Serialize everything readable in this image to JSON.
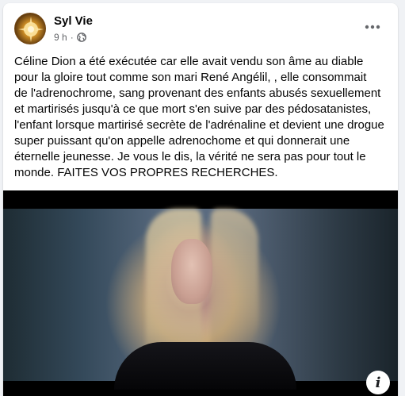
{
  "post": {
    "author": "Syl Vie",
    "time": "9 h",
    "separator": "·",
    "privacy_icon": "globe-icon",
    "more_icon": "more-options-icon",
    "text": "Céline Dion a été exécutée car elle avait vendu son âme au diable\npour la gloire tout comme son mari René Angélil, , elle consommait\nde l'adrenochrome, sang provenant des enfants abusés sexuellement\net martirisés jusqu'à ce que mort s'en suive par des pédosatanistes,\nl'enfant lorsque martirisé secrète de l'adrénaline et devient une drogue\nsuper puissant qu'on appelle adrenochome et qui donnerait une\néternelle jeunesse. Je vous le dis, la vérité ne sera pas pour tout le\nmonde. FAITES VOS PROPRES RECHERCHES."
  },
  "media": {
    "info_label": "i",
    "info_icon": "info-icon"
  },
  "colors": {
    "text": "#050505",
    "meta": "#65676b",
    "background": "#f0f2f5",
    "card": "#ffffff"
  }
}
